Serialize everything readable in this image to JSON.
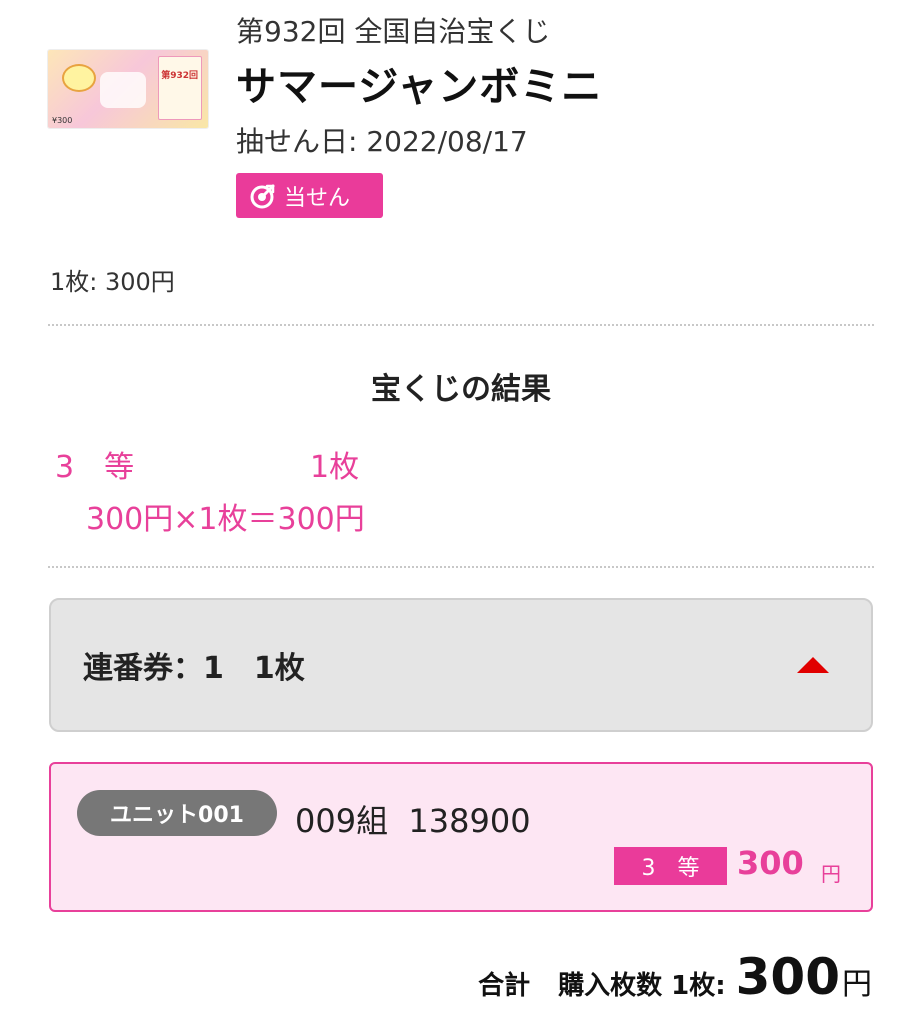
{
  "ticket": {
    "image_alt": "ticket-image",
    "thumb_number": "第932回",
    "thumb_price": "¥300"
  },
  "draw": {
    "round": "第932回 全国自治宝くじ",
    "title": "サマージャンボミニ",
    "date_label": "抽せん日: 2022/08/17"
  },
  "badge": {
    "label": "当せん",
    "color": "#ea3b9a"
  },
  "unit_price": "1枚: 300円",
  "results": {
    "section_title": "宝くじの結果",
    "rank": "3　等",
    "count": "1枚",
    "calc": "300円×1枚＝300円"
  },
  "accordion": {
    "label": "連番券：1　1枚",
    "caret_icon": "caret-up-icon",
    "caret_color": "#e10000"
  },
  "unit": {
    "pill": "ユニット001",
    "number": "009組  138900",
    "prize_rank": "3　等",
    "prize_amount": "300",
    "prize_unit": "円"
  },
  "total": {
    "label": "合計",
    "count_label": "購入枚数 1枚:",
    "amount": "300",
    "unit": "円"
  },
  "colors": {
    "accent_pink": "#e8409a",
    "card_bg": "#fde6f3",
    "accordion_bg": "#e5e5e5"
  }
}
